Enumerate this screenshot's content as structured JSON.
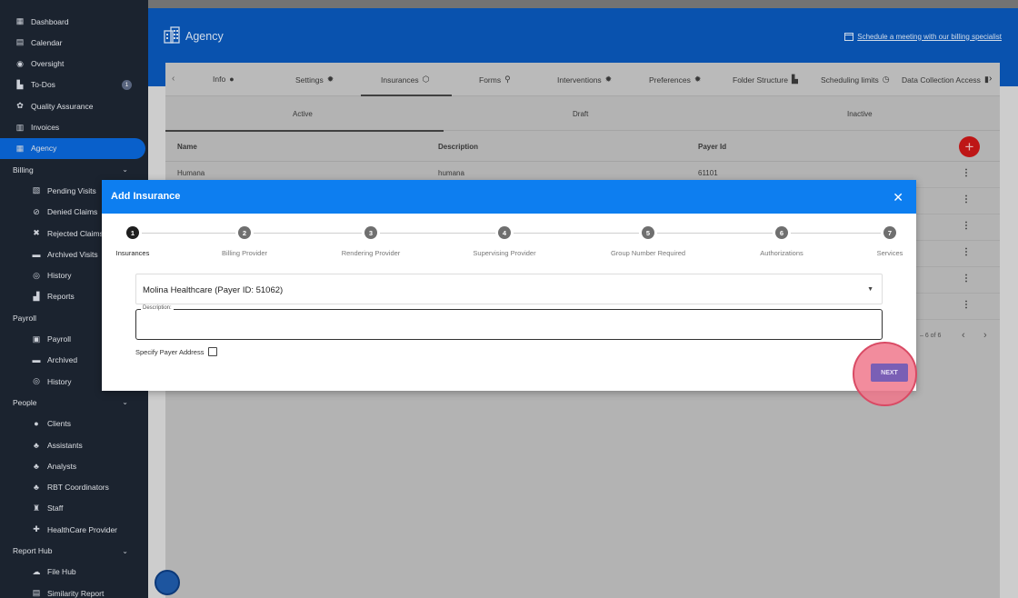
{
  "sidebar": {
    "items": [
      {
        "label": "Dashboard",
        "icon": "dashboard-icon",
        "glyph": "▦",
        "level": "main"
      },
      {
        "label": "Calendar",
        "icon": "calendar-icon",
        "glyph": "▤",
        "level": "main"
      },
      {
        "label": "Oversight",
        "icon": "eye-icon",
        "glyph": "◉",
        "level": "main"
      },
      {
        "label": "To-Dos",
        "icon": "todo-icon",
        "glyph": "▙",
        "level": "main",
        "badge": "1"
      },
      {
        "label": "Quality Assurance",
        "icon": "quality-icon",
        "glyph": "✿",
        "level": "main"
      },
      {
        "label": "Invoices",
        "icon": "invoice-icon",
        "glyph": "▥",
        "level": "main"
      },
      {
        "label": "Agency",
        "icon": "building-icon",
        "glyph": "▦",
        "level": "main",
        "active": true
      },
      {
        "label": "Billing",
        "level": "section",
        "chevron": true
      },
      {
        "label": "Pending Visits",
        "icon": "pending-icon",
        "glyph": "▧",
        "level": "sub"
      },
      {
        "label": "Denied Claims",
        "icon": "denied-icon",
        "glyph": "⊘",
        "level": "sub"
      },
      {
        "label": "Rejected Claims",
        "icon": "rejected-icon",
        "glyph": "✖",
        "level": "sub"
      },
      {
        "label": "Archived Visits",
        "icon": "archive-icon",
        "glyph": "▬",
        "level": "sub"
      },
      {
        "label": "History",
        "icon": "history-icon",
        "glyph": "◎",
        "level": "sub"
      },
      {
        "label": "Reports",
        "icon": "reports-icon",
        "glyph": "▟",
        "level": "sub"
      },
      {
        "label": "Payroll",
        "level": "section"
      },
      {
        "label": "Payroll",
        "icon": "payroll-icon",
        "glyph": "▣",
        "level": "sub"
      },
      {
        "label": "Archived",
        "icon": "archive-icon",
        "glyph": "▬",
        "level": "sub"
      },
      {
        "label": "History",
        "icon": "history-icon",
        "glyph": "◎",
        "level": "sub"
      },
      {
        "label": "People",
        "level": "section",
        "chevron": true
      },
      {
        "label": "Clients",
        "icon": "user-icon",
        "glyph": "●",
        "level": "sub"
      },
      {
        "label": "Assistants",
        "icon": "users-icon",
        "glyph": "♣",
        "level": "sub"
      },
      {
        "label": "Analysts",
        "icon": "users-icon",
        "glyph": "♣",
        "level": "sub"
      },
      {
        "label": "RBT Coordinators",
        "icon": "users-icon",
        "glyph": "♣",
        "level": "sub"
      },
      {
        "label": "Staff",
        "icon": "staff-icon",
        "glyph": "♜",
        "level": "sub"
      },
      {
        "label": "HealthCare Provider",
        "icon": "provider-icon",
        "glyph": "✚",
        "level": "sub"
      },
      {
        "label": "Report Hub",
        "level": "section",
        "chevron": true
      },
      {
        "label": "File Hub",
        "icon": "cloud-icon",
        "glyph": "☁",
        "level": "sub"
      },
      {
        "label": "Similarity Report",
        "icon": "report-icon",
        "glyph": "▤",
        "level": "sub"
      }
    ]
  },
  "header": {
    "title": "Agency",
    "meeting_link": "Schedule a meeting with our billing specialist"
  },
  "tabs": [
    {
      "label": "Info",
      "glyph": "●"
    },
    {
      "label": "Settings",
      "glyph": "✹"
    },
    {
      "label": "Insurances",
      "glyph": "⬡",
      "active": true
    },
    {
      "label": "Forms",
      "glyph": "⚲"
    },
    {
      "label": "Interventions",
      "glyph": "✹"
    },
    {
      "label": "Preferences",
      "glyph": "✹"
    },
    {
      "label": "Folder Structure",
      "glyph": "▙"
    },
    {
      "label": "Scheduling limits",
      "glyph": "◷"
    },
    {
      "label": "Data Collection Access",
      "glyph": "▮"
    }
  ],
  "subtabs": [
    "Active",
    "Draft",
    "Inactive"
  ],
  "table": {
    "columns": [
      "Name",
      "Description",
      "Payer Id"
    ],
    "rows": [
      {
        "name": "Humana",
        "description": "humana",
        "payer_id": "61101"
      },
      {
        "name": "",
        "description": "",
        "payer_id": ""
      },
      {
        "name": "",
        "description": "",
        "payer_id": ""
      },
      {
        "name": "",
        "description": "",
        "payer_id": ""
      },
      {
        "name": "",
        "description": "",
        "payer_id": ""
      },
      {
        "name": "",
        "description": "",
        "payer_id": ""
      }
    ],
    "pagination": "– 6 of 6"
  },
  "modal": {
    "title": "Add Insurance",
    "steps": [
      {
        "num": "1",
        "label": "Insurances",
        "active": true
      },
      {
        "num": "2",
        "label": "Billing Provider"
      },
      {
        "num": "3",
        "label": "Rendering Provider"
      },
      {
        "num": "4",
        "label": "Supervising Provider"
      },
      {
        "num": "5",
        "label": "Group Number Required"
      },
      {
        "num": "6",
        "label": "Authorizations"
      },
      {
        "num": "7",
        "label": "Services"
      }
    ],
    "insurance_select_value": "Molina Healthcare (Payer ID: 51062)",
    "description_label": "Description:",
    "description_value": "",
    "specify_payer_address_label": "Specify Payer Address",
    "next_label": "NEXT"
  },
  "colors": {
    "sidebar_bg": "#1d2532",
    "active_blue": "#0a66d6",
    "header_blue": "#0a57b8",
    "modal_header": "#0d7ef0",
    "add_button": "#c91818",
    "next_button": "#7a5fb5",
    "highlight": "#f0788c"
  }
}
